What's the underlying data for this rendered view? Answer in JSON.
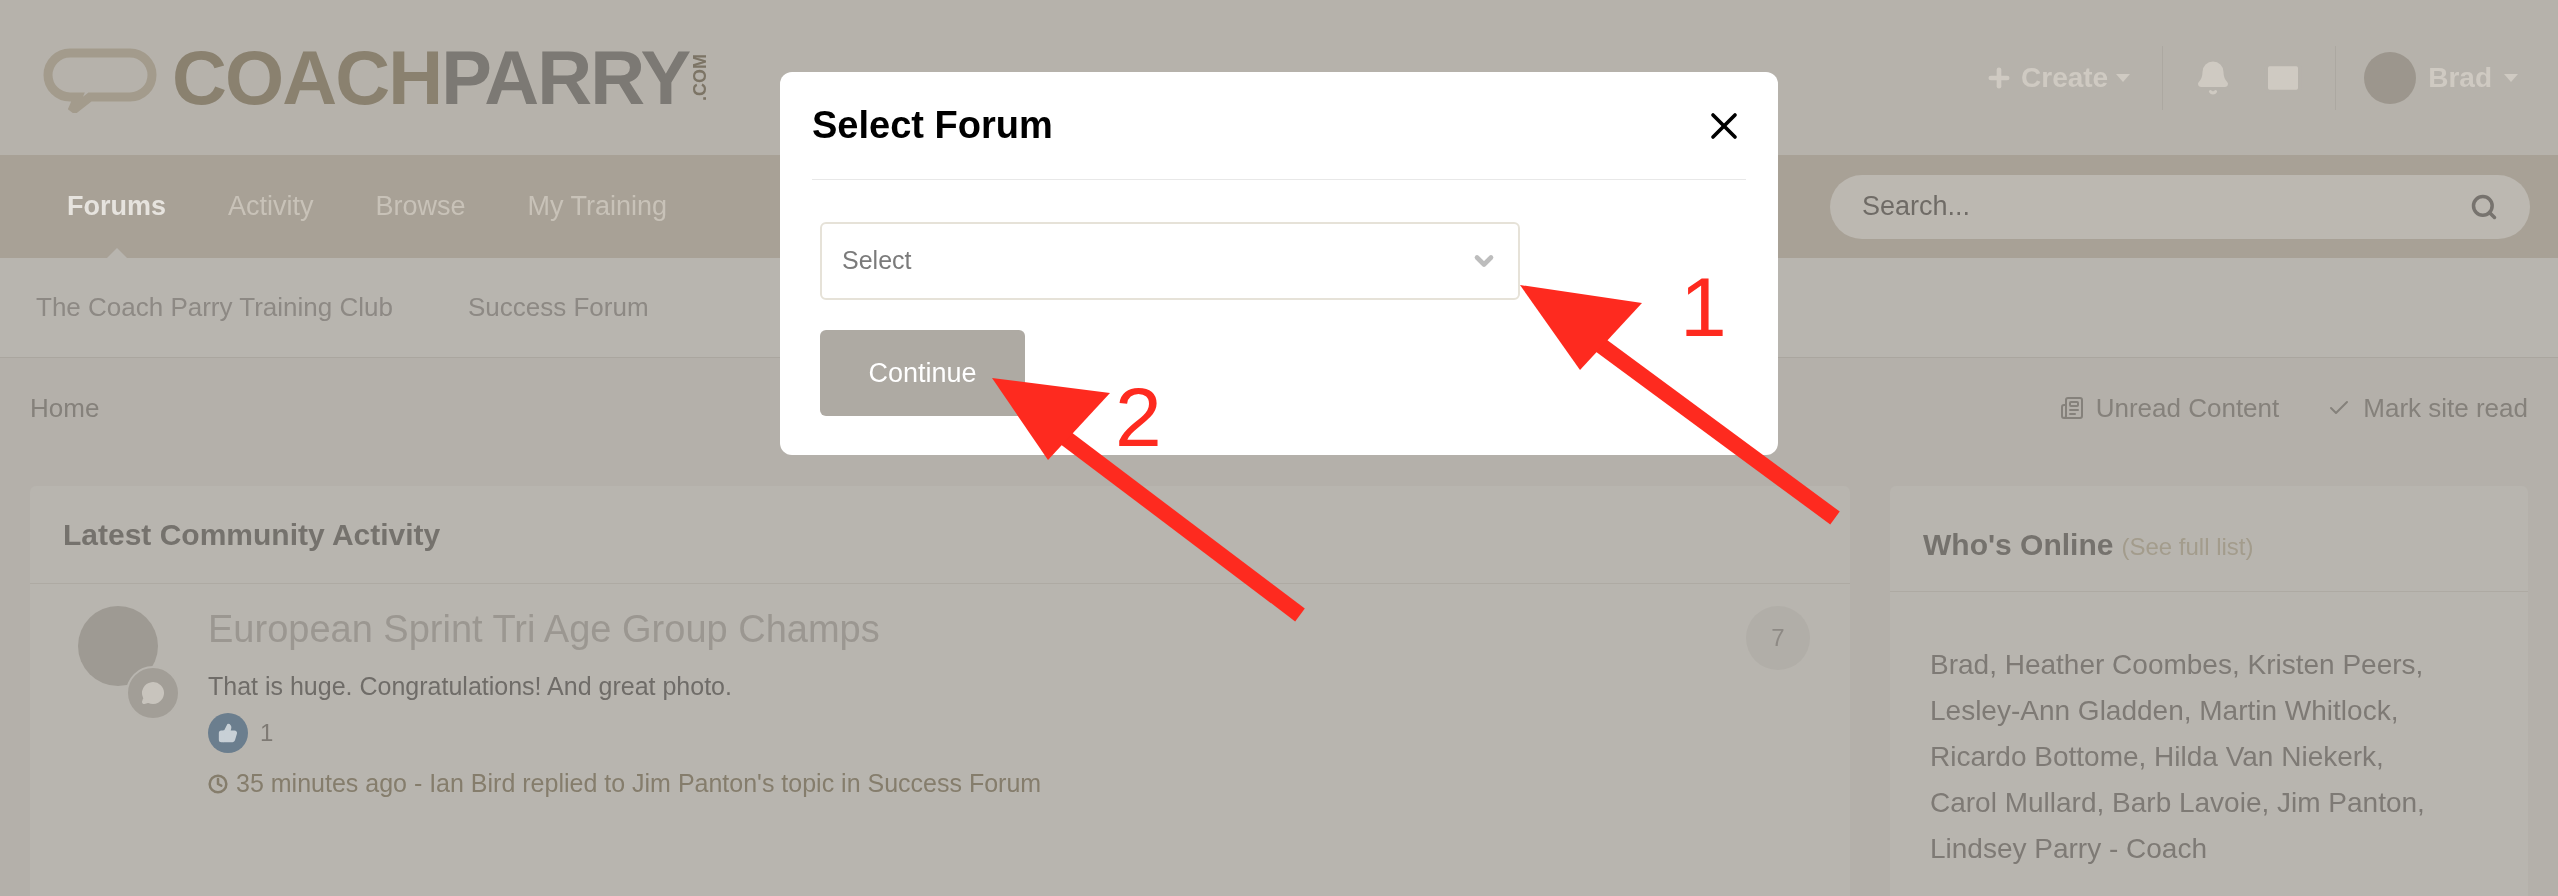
{
  "header": {
    "logo": {
      "word_1": "COACH",
      "word_2": "PARRY",
      "suffix": ".COM"
    },
    "create": "Create",
    "user": "Brad"
  },
  "nav": {
    "tabs": [
      {
        "label": "Forums",
        "selected": true
      },
      {
        "label": "Activity",
        "selected": false
      },
      {
        "label": "Browse",
        "selected": false
      },
      {
        "label": "My Training",
        "selected": false
      }
    ],
    "search": {
      "placeholder": "Search..."
    }
  },
  "subnav": [
    "The Coach Parry Training Club",
    "Success Forum"
  ],
  "breadcrumb": {
    "home": "Home",
    "actions": [
      {
        "kind": "unread",
        "label": "Unread Content"
      },
      {
        "kind": "mark",
        "label": "Mark site read"
      }
    ]
  },
  "activity": {
    "title": "Latest Community Activity",
    "items": [
      {
        "title": "European Sprint Tri Age Group Champs",
        "text": "That is huge. Congratulations! And great photo.",
        "likes": "1",
        "meta": "35 minutes ago - Ian Bird replied to Jim Panton's topic in Success Forum",
        "count": "7"
      }
    ]
  },
  "online": {
    "title": "Who's Online",
    "link": "(See full list)",
    "names": "Brad, Heather Coombes, Kristen Peers, Lesley-Ann Gladden, Martin Whitlock, Ricardo Bottome, Hilda Van Niekerk, Carol Mullard, Barb Lavoie, Jim Panton, Lindsey Parry - Coach"
  },
  "modal": {
    "title": "Select Forum",
    "select": {
      "placeholder": "Select"
    },
    "button": "Continue"
  },
  "annotations": [
    {
      "label": "1"
    },
    {
      "label": "2"
    }
  ]
}
